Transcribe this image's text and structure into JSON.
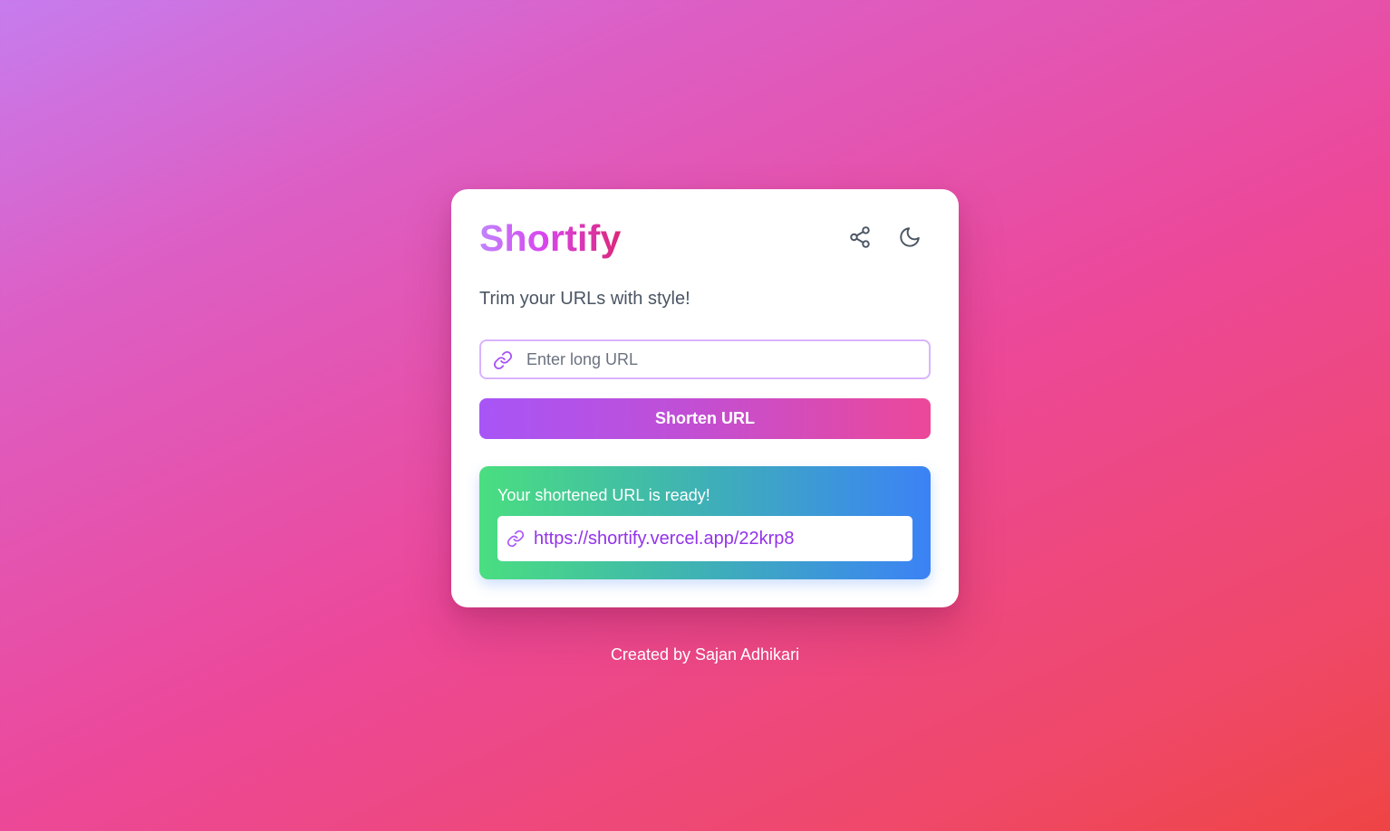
{
  "app": {
    "title": "Shortify",
    "tagline": "Trim your URLs with style!"
  },
  "header": {
    "share_icon": "share-icon",
    "theme_icon": "moon-icon"
  },
  "form": {
    "url_input": {
      "value": "",
      "placeholder": "Enter long URL",
      "icon": "link-icon"
    },
    "submit_label": "Shorten URL"
  },
  "result": {
    "title": "Your shortened URL is ready!",
    "short_url": "https://shortify.vercel.app/22krp8",
    "icon": "link-icon"
  },
  "footer": {
    "credit": "Created by Sajan Adhikari"
  },
  "colors": {
    "brand_gradient_start": "#c084fc",
    "brand_gradient_end": "#db2777",
    "button_gradient_start": "#a855f7",
    "button_gradient_end": "#ec4899",
    "result_gradient_start": "#4ade80",
    "result_gradient_end": "#3b82f6",
    "link_color": "#9333ea",
    "input_border": "#d8b4fe"
  }
}
